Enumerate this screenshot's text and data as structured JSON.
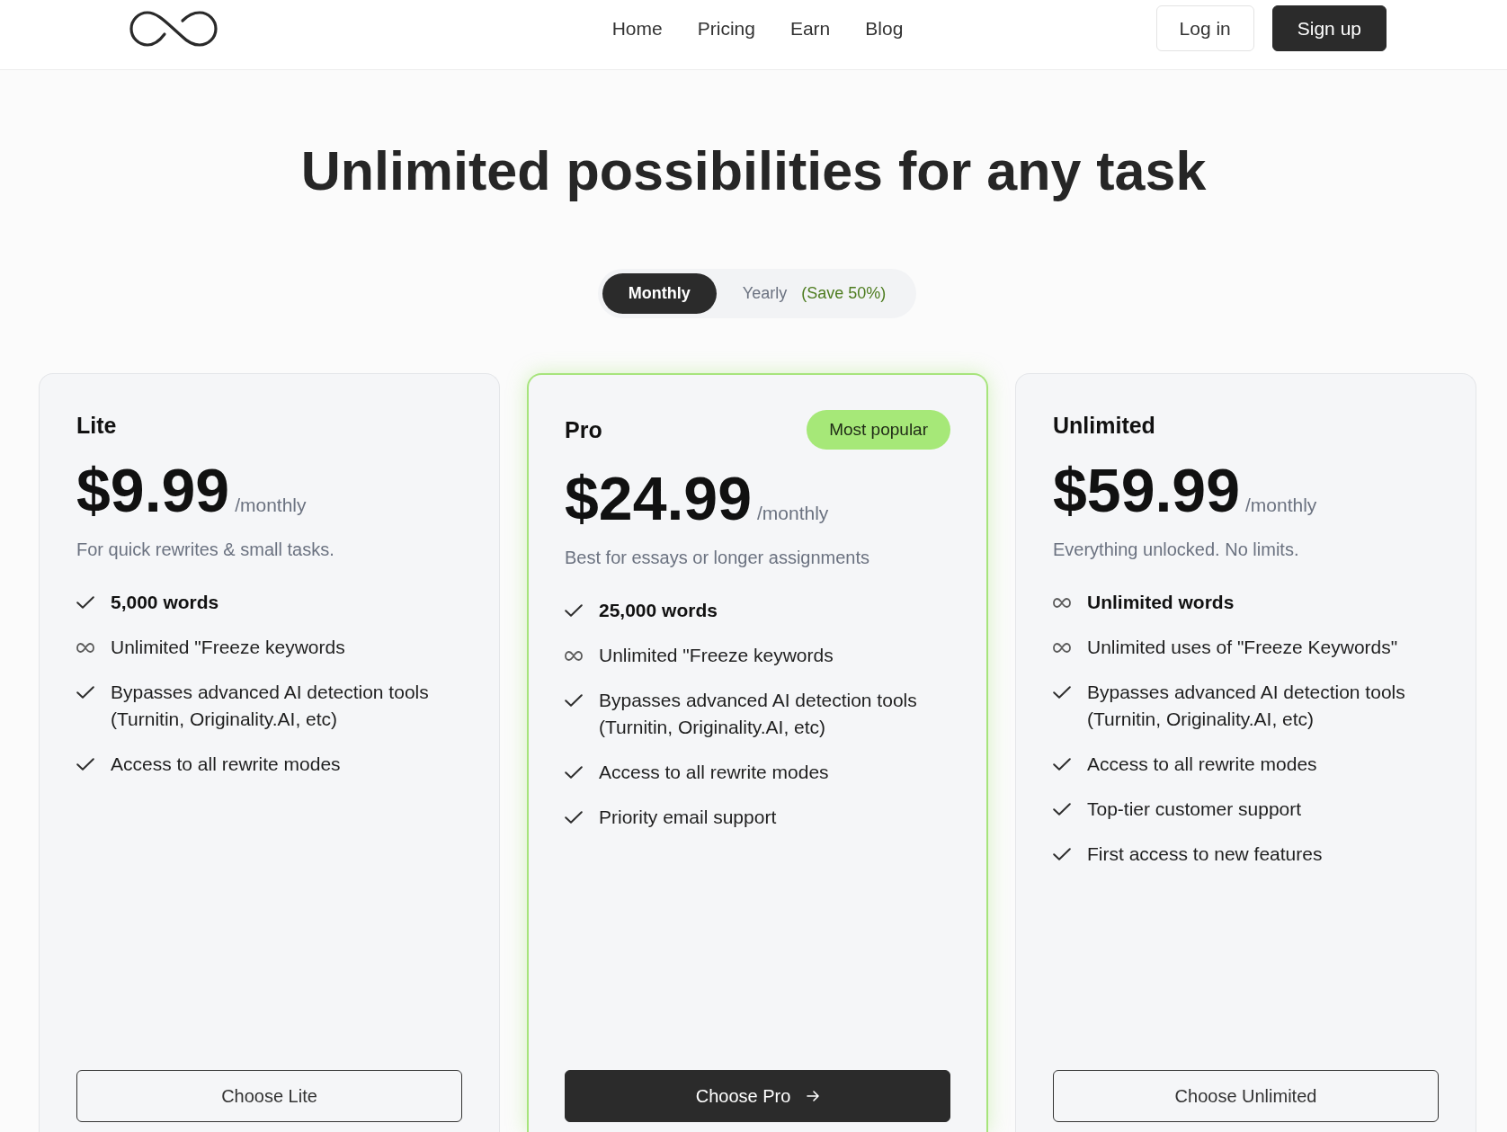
{
  "header": {
    "nav": [
      {
        "label": "Home"
      },
      {
        "label": "Pricing"
      },
      {
        "label": "Earn"
      },
      {
        "label": "Blog"
      }
    ],
    "actions": [
      {
        "label": "Log in",
        "kind": "outline"
      },
      {
        "label": "Sign up",
        "kind": "solid"
      }
    ]
  },
  "title": "Unlimited possibilities for any task",
  "billing_toggle": [
    {
      "label": "Monthly",
      "selected": true
    },
    {
      "label": "Yearly",
      "note": "(Save 50%)",
      "selected": false
    }
  ],
  "plans": [
    {
      "name": "Lite",
      "featured": false,
      "price": "$9.99",
      "period": "/monthly",
      "description": "For quick rewrites & small tasks.",
      "features": [
        {
          "kind": "check",
          "text": "5,000 words",
          "bold": true
        },
        {
          "kind": "infinity",
          "text": "Unlimited \"Freeze keywords",
          "bold": false
        },
        {
          "kind": "check",
          "text": "Bypasses advanced AI detection tools (Turnitin, Originality.AI, etc)",
          "bold": false
        },
        {
          "kind": "check",
          "text": "Access to all rewrite modes",
          "bold": false
        }
      ],
      "button": "Choose Lite"
    },
    {
      "name": "Pro",
      "badge": "Most popular",
      "featured": true,
      "price": "$24.99",
      "period": "/monthly",
      "description": "Best for essays or longer assignments",
      "features": [
        {
          "kind": "check",
          "text": "25,000 words",
          "bold": true
        },
        {
          "kind": "infinity",
          "text": "Unlimited \"Freeze keywords",
          "bold": false
        },
        {
          "kind": "check",
          "text": "Bypasses advanced AI detection tools (Turnitin, Originality.AI, etc)",
          "bold": false
        },
        {
          "kind": "check",
          "text": "Access to all rewrite modes",
          "bold": false
        },
        {
          "kind": "check",
          "text": "Priority email support",
          "bold": false
        }
      ],
      "button": "Choose Pro"
    },
    {
      "name": "Unlimited",
      "featured": false,
      "price": "$59.99",
      "period": "/monthly",
      "description": "Everything unlocked. No limits.",
      "features": [
        {
          "kind": "infinity",
          "text": "Unlimited words",
          "bold": true
        },
        {
          "kind": "infinity",
          "text": "Unlimited uses of \"Freeze Keywords\"",
          "bold": false
        },
        {
          "kind": "check",
          "text": "Bypasses advanced AI detection tools (Turnitin, Originality.AI, etc)",
          "bold": false
        },
        {
          "kind": "check",
          "text": "Access to all rewrite modes",
          "bold": false
        },
        {
          "kind": "check",
          "text": "Top-tier customer support",
          "bold": false
        },
        {
          "kind": "check",
          "text": "First access to new features",
          "bold": false
        }
      ],
      "button": "Choose Unlimited"
    }
  ]
}
